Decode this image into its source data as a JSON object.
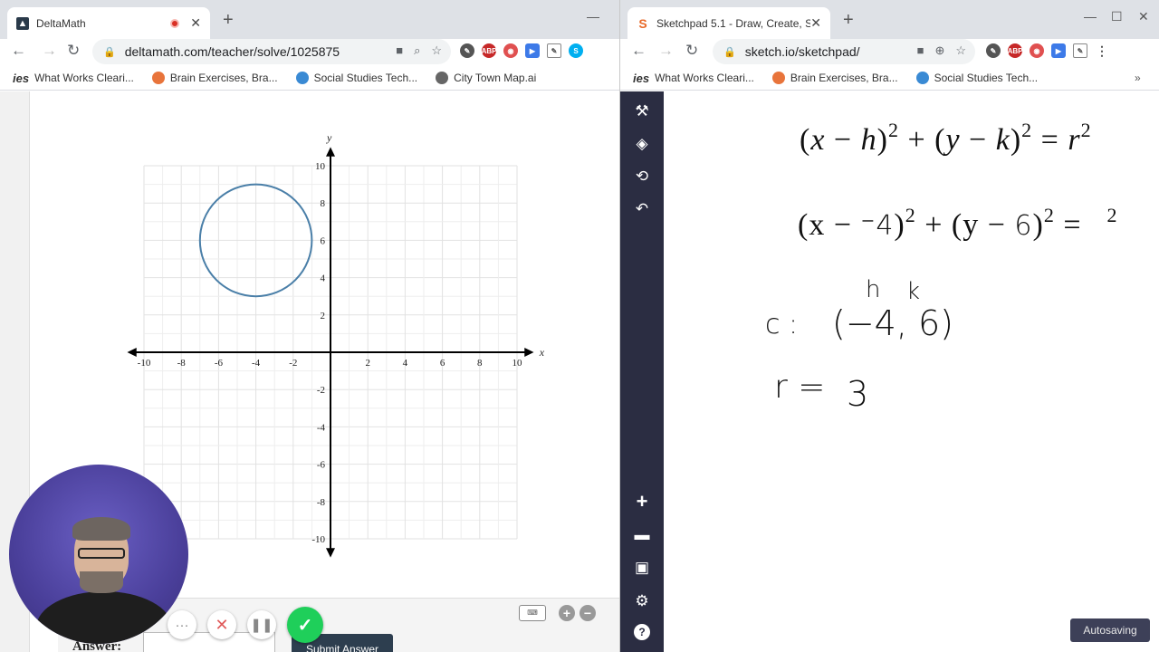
{
  "left_browser": {
    "tab_title": "DeltaMath",
    "url": "deltamath.com/teacher/solve/1025875",
    "bookmarks": [
      "What Works Cleari...",
      "Brain Exercises, Bra...",
      "Social Studies Tech...",
      "City Town Map.ai"
    ]
  },
  "right_browser": {
    "tab_title": "Sketchpad 5.1 - Draw, Create, Sh",
    "url": "sketch.io/sketchpad/",
    "bookmarks": [
      "What Works Cleari...",
      "Brain Exercises, Bra...",
      "Social Studies Tech..."
    ]
  },
  "graph": {
    "x_axis_label": "x",
    "y_axis_label": "y",
    "x_ticks": [
      "-10",
      "-8",
      "-6",
      "-4",
      "-2",
      "2",
      "4",
      "6",
      "8",
      "10"
    ],
    "y_ticks": [
      "10",
      "8",
      "6",
      "4",
      "2",
      "-2",
      "-4",
      "-6",
      "-8",
      "-10"
    ],
    "circle_center": [
      -4,
      6
    ],
    "circle_radius": 3,
    "circle_color": "#4a7fa8"
  },
  "answer": {
    "label": "Answer:",
    "submit_label": "Submit Answer"
  },
  "recorder": {
    "more": "···",
    "cancel": "✕",
    "pause": "❚❚",
    "done": "✓"
  },
  "sketch": {
    "formula_general": {
      "a": "(",
      "x": "x",
      "b": " − ",
      "h": "h",
      "c": ")",
      "e1": "2",
      "d": " + (",
      "y": "y",
      "k": "k",
      "e2": "2",
      "eq": " = ",
      "r": "r",
      "e3": "2"
    },
    "formula_specific": {
      "p1": "(x − ",
      "hval": "⁻4",
      "p2": ")",
      "e1": "2",
      "p3": " + (y − ",
      "kval": "6",
      "p4": ")",
      "e2": "2",
      "p5": " =",
      "e3": "2"
    },
    "handwriting": {
      "h": "h",
      "k": "k",
      "c_label": "c :",
      "center": "(−4, 6)",
      "r_label": "r =",
      "r_value": "3"
    },
    "autosave": "Autosaving"
  }
}
